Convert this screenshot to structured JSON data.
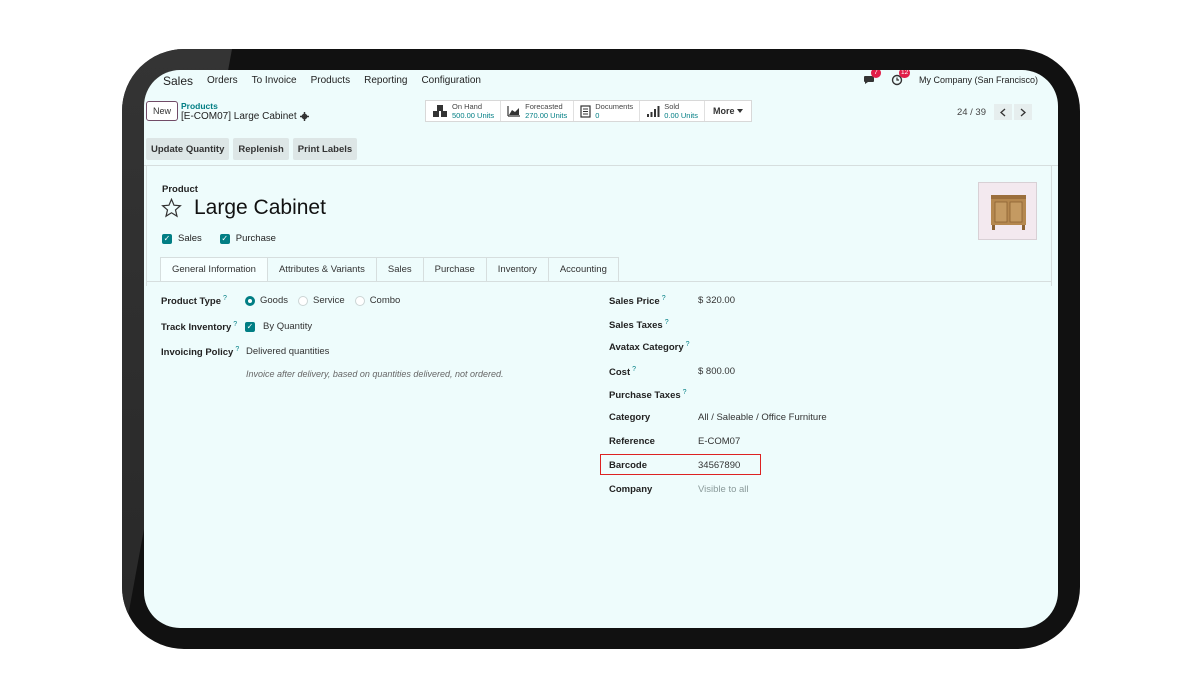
{
  "navbar": {
    "app": "Sales",
    "items": [
      "Orders",
      "To Invoice",
      "Products",
      "Reporting",
      "Configuration"
    ],
    "messages_badge": "7",
    "activities_badge": "12",
    "company": "My Company (San Francisco)"
  },
  "control": {
    "new_label": "New",
    "breadcrumb_parent": "Products",
    "breadcrumb_current": "[E-COM07] Large Cabinet",
    "smart_buttons": [
      {
        "label": "On Hand",
        "value": "500.00 Units",
        "icon": "cubes-icon"
      },
      {
        "label": "Forecasted",
        "value": "270.00 Units",
        "icon": "area-chart-icon"
      },
      {
        "label": "Documents",
        "value": "0",
        "icon": "document-icon"
      },
      {
        "label": "Sold",
        "value": "0.00 Units",
        "icon": "signal-bars-icon"
      }
    ],
    "more_label": "More",
    "pager": "24 / 39"
  },
  "actions": [
    "Update Quantity",
    "Replenish",
    "Print Labels"
  ],
  "form": {
    "product_label": "Product",
    "title": "Large Cabinet",
    "checks": [
      {
        "label": "Sales",
        "checked": true
      },
      {
        "label": "Purchase",
        "checked": true
      }
    ],
    "tabs": [
      "General Information",
      "Attributes & Variants",
      "Sales",
      "Purchase",
      "Inventory",
      "Accounting"
    ],
    "active_tab": "General Information",
    "left": {
      "product_type_label": "Product Type",
      "product_type_options": [
        "Goods",
        "Service",
        "Combo"
      ],
      "product_type_selected": "Goods",
      "track_inventory_label": "Track Inventory",
      "track_inventory_value": "By Quantity",
      "invoicing_policy_label": "Invoicing Policy",
      "invoicing_policy_value": "Delivered quantities",
      "invoicing_hint": "Invoice after delivery, based on quantities delivered, not ordered."
    },
    "right": {
      "sales_price_label": "Sales Price",
      "sales_price": "$ 320.00",
      "sales_taxes_label": "Sales Taxes",
      "avatax_label": "Avatax Category",
      "cost_label": "Cost",
      "cost": "$ 800.00",
      "purchase_taxes_label": "Purchase Taxes",
      "category_label": "Category",
      "category": "All / Saleable / Office Furniture",
      "reference_label": "Reference",
      "reference": "E-COM07",
      "barcode_label": "Barcode",
      "barcode": "34567890",
      "company_label": "Company",
      "company": "Visible to all"
    }
  },
  "tooltip_mark": "?",
  "colors": {
    "accent": "#017e84",
    "brand": "#714b67",
    "highlight": "#dd2222",
    "background": "#eefcfc"
  }
}
